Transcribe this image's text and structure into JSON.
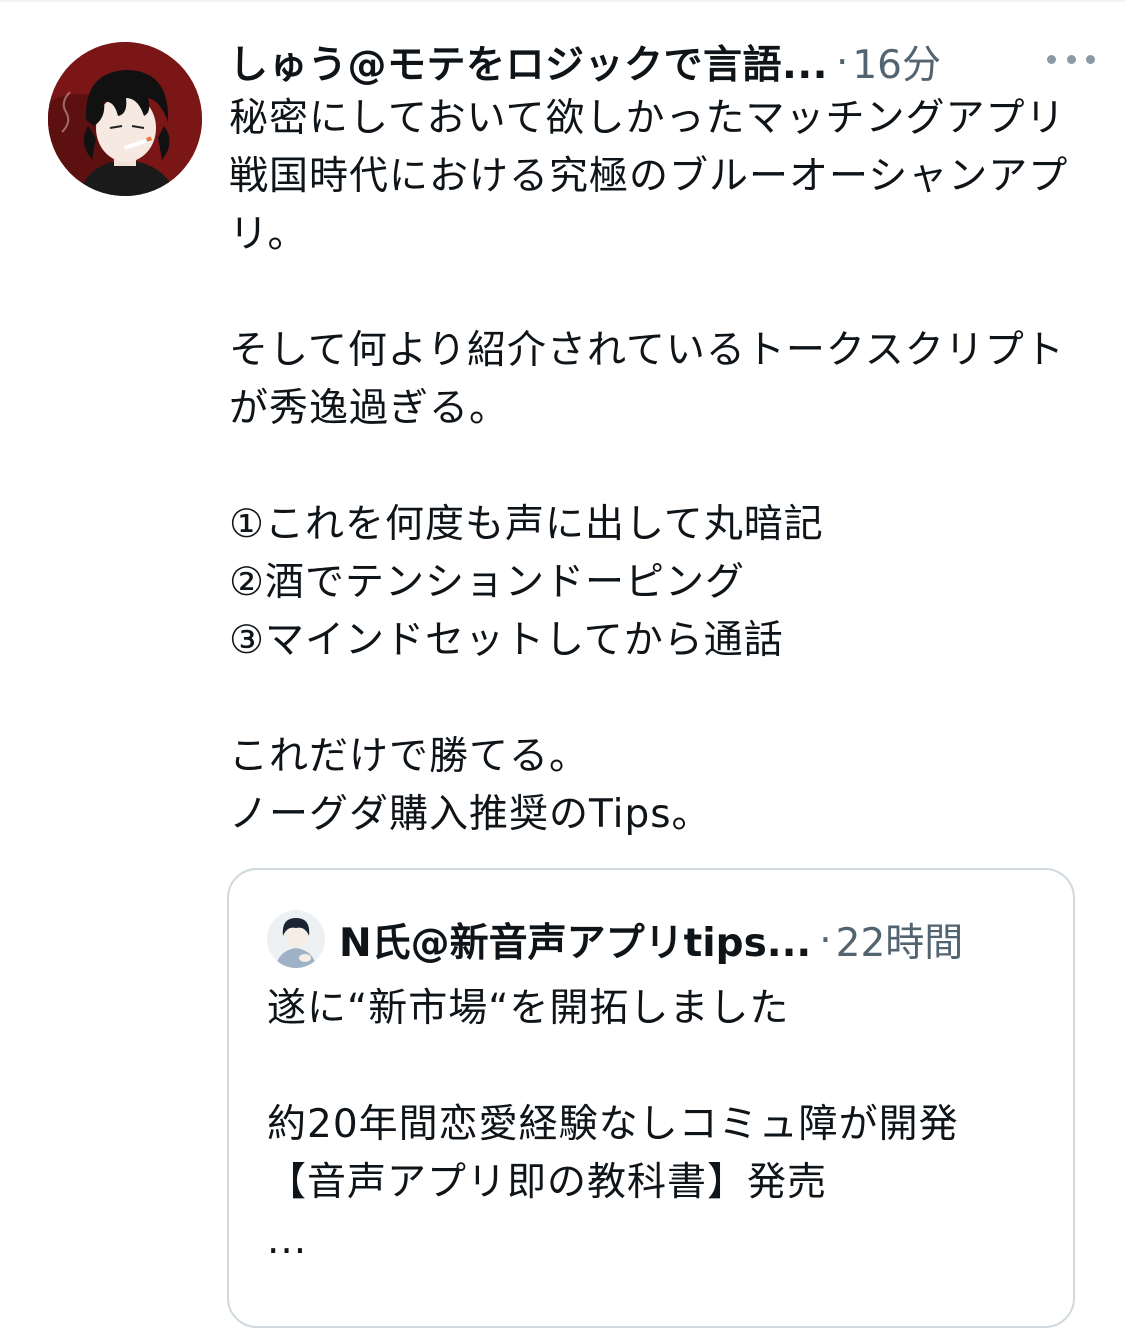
{
  "tweet": {
    "display_name": "しゅう@モテをロジックで言語...",
    "separator": "·",
    "time": "16分",
    "avatar": "avatar-dark-hair-smoking-character",
    "more_icon": "more-horizontal-icon",
    "text": "秘密にしておいて欲しかったマッチングアプリ戦国時代における究極のブルーオーシャンアプリ。\n\nそして何より紹介されているトークスクリプトが秀逸過ぎる。\n\n①これを何度も声に出して丸暗記\n②酒でテンションドーピング\n③マインドセットしてから通話\n\nこれだけで勝てる。\nノーグダ購入推奨のTips。"
  },
  "quote": {
    "display_name": "N氏@新音声アプリtips...",
    "separator": "·",
    "time": "22時間",
    "avatar": "avatar-illustrated-person",
    "text": "遂に“新市場“を開拓しました\n\n約20年間恋愛経験なしコミュ障が開発\n【音声アプリ即の教科書】発売\n..."
  },
  "colors": {
    "primary_text": "#0f1419",
    "secondary_text": "#536471",
    "border": "#cfd9de",
    "avatar_background": "#7a1616"
  }
}
